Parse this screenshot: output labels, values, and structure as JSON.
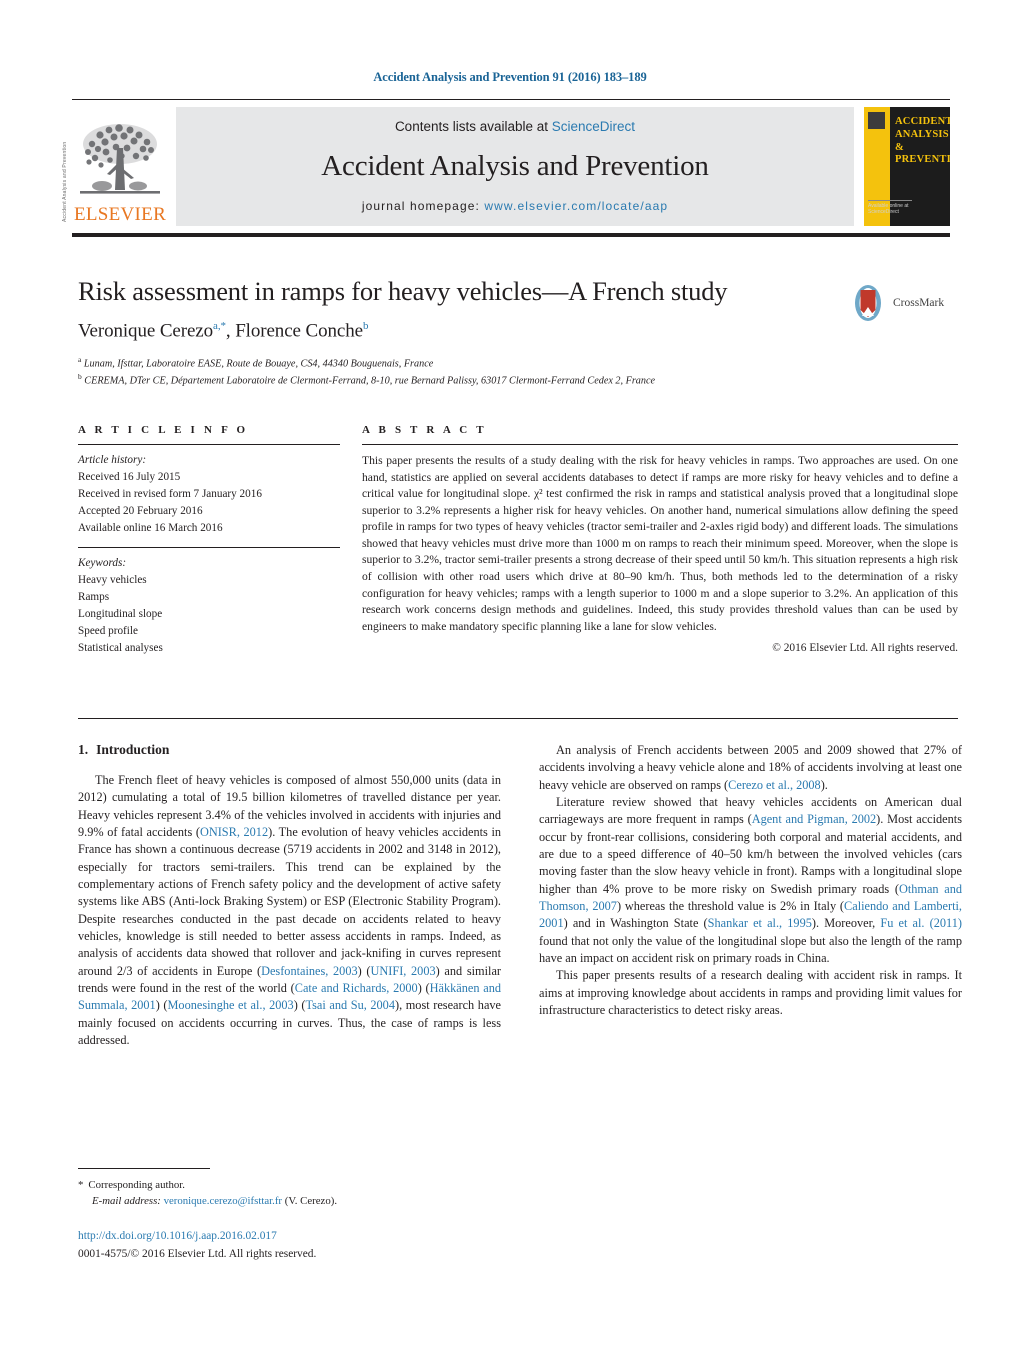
{
  "running_head": "Accident Analysis and Prevention 91 (2016) 183–189",
  "masthead": {
    "contents_prefix": "Contents lists available at ",
    "contents_link": "ScienceDirect",
    "journal_title": "Accident Analysis and Prevention",
    "homepage_prefix": "journal homepage: ",
    "homepage_url": "www.elsevier.com/locate/aap",
    "publisher_wordmark": "ELSEVIER",
    "cover_title": "ACCIDENT ANALYSIS & PREVENTION",
    "cover_footer": "Available online at ScienceDirect",
    "spine_text": "Accident Analysis and Prevention"
  },
  "article": {
    "title": "Risk assessment in ramps for heavy vehicles—A French study",
    "authors_html": "Veronique Cerezo<sup>a,*</sup>, Florence Conche<sup>b</sup>",
    "author_1": "Veronique Cerezo",
    "author_2": "Florence Conche",
    "affiliation_a": "Lunam, Ifsttar, Laboratoire EASE, Route de Bouaye, CS4, 44340 Bouguenais, France",
    "affiliation_b": "CEREMA, DTer CE, Département Laboratoire de Clermont-Ferrand, 8-10, rue Bernard Palissy, 63017 Clermont-Ferrand Cedex 2, France",
    "crossmark_label": "CrossMark"
  },
  "info": {
    "heading": "A R T I C L E   I N F O",
    "history_label": "Article history:",
    "history": [
      "Received 16 July 2015",
      "Received in revised form 7 January 2016",
      "Accepted 20 February 2016",
      "Available online 16 March 2016"
    ],
    "keywords_label": "Keywords:",
    "keywords": [
      "Heavy vehicles",
      "Ramps",
      "Longitudinal slope",
      "Speed profile",
      "Statistical analyses"
    ]
  },
  "abstract": {
    "heading": "A B S T R A C T",
    "text": "This paper presents the results of a study dealing with the risk for heavy vehicles in ramps. Two approaches are used. On one hand, statistics are applied on several accidents databases to detect if ramps are more risky for heavy vehicles and to define a critical value for longitudinal slope. χ² test confirmed the risk in ramps and statistical analysis proved that a longitudinal slope superior to 3.2% represents a higher risk for heavy vehicles. On another hand, numerical simulations allow defining the speed profile in ramps for two types of heavy vehicles (tractor semi-trailer and 2-axles rigid body) and different loads. The simulations showed that heavy vehicles must drive more than 1000 m on ramps to reach their minimum speed. Moreover, when the slope is superior to 3.2%, tractor semi-trailer presents a strong decrease of their speed until 50 km/h. This situation represents a high risk of collision with other road users which drive at 80–90 km/h. Thus, both methods led to the determination of a risky configuration for heavy vehicles; ramps with a length superior to 1000 m and a slope superior to 3.2%. An application of this research work concerns design methods and guidelines. Indeed, this study provides threshold values than can be used by engineers to make mandatory specific planning like a lane for slow vehicles.",
    "copyright": "© 2016 Elsevier Ltd. All rights reserved."
  },
  "section": {
    "number": "1.",
    "heading": "Introduction"
  },
  "body": {
    "left": [
      {
        "runs": [
          {
            "t": "The French fleet of heavy vehicles is composed of almost 550,000 units (data in 2012) cumulating a total of 19.5 billion kilometres of travelled distance per year. Heavy vehicles represent 3.4% of the vehicles involved in accidents with injuries and 9.9% of fatal accidents (",
            "k": "n"
          },
          {
            "t": "ONISR, 2012",
            "k": "r"
          },
          {
            "t": "). The evolution of heavy vehicles accidents in France has shown a continuous decrease (5719 accidents in 2002 and 3148 in 2012), especially for tractors semi-trailers. This trend can be explained by the complementary actions of French safety policy and the development of active safety systems like ABS (Anti-lock Braking System) or ESP (Electronic Stability Program). Despite researches conducted in the past decade on accidents related to heavy vehicles, knowledge is still needed to better assess accidents in ramps. Indeed, as analysis of accidents data showed that rollover and jack-knifing in curves represent around 2/3 of accidents in Europe (",
            "k": "n"
          },
          {
            "t": "Desfontaines, 2003",
            "k": "r"
          },
          {
            "t": ") (",
            "k": "n"
          },
          {
            "t": "UNIFI, 2003",
            "k": "r"
          },
          {
            "t": ") and similar trends were found in the rest of the world (",
            "k": "n"
          },
          {
            "t": "Cate and Richards, 2000",
            "k": "r"
          },
          {
            "t": ") (",
            "k": "n"
          },
          {
            "t": "Häkkänen and Summala, 2001",
            "k": "r"
          },
          {
            "t": ") (",
            "k": "n"
          },
          {
            "t": "Moonesinghe et al., 2003",
            "k": "r"
          },
          {
            "t": ") (",
            "k": "n"
          },
          {
            "t": "Tsai and Su, 2004",
            "k": "r"
          },
          {
            "t": "), most research have mainly focused on accidents occurring in curves. Thus, the case of ramps is less addressed.",
            "k": "n"
          }
        ]
      }
    ],
    "right": [
      {
        "runs": [
          {
            "t": "An analysis of French accidents between 2005 and 2009 showed that 27% of accidents involving a heavy vehicle alone and 18% of accidents involving at least one heavy vehicle are observed on ramps (",
            "k": "n"
          },
          {
            "t": "Cerezo et al., 2008",
            "k": "r"
          },
          {
            "t": ").",
            "k": "n"
          }
        ]
      },
      {
        "runs": [
          {
            "t": "Literature review showed that heavy vehicles accidents on American dual carriageways are more frequent in ramps (",
            "k": "n"
          },
          {
            "t": "Agent and Pigman, 2002",
            "k": "r"
          },
          {
            "t": "). Most accidents occur by front-rear collisions, considering both corporal and material accidents, and are due to a speed difference of 40–50 km/h between the involved vehicles (cars moving faster than the slow heavy vehicle in front). Ramps with a longitudinal slope higher than 4% prove to be more risky on Swedish primary roads (",
            "k": "n"
          },
          {
            "t": "Othman and Thomson, 2007",
            "k": "r"
          },
          {
            "t": ") whereas the threshold value is 2% in Italy (",
            "k": "n"
          },
          {
            "t": "Caliendo and Lamberti, 2001",
            "k": "r"
          },
          {
            "t": ") and in Washington State (",
            "k": "n"
          },
          {
            "t": "Shankar et al., 1995",
            "k": "r"
          },
          {
            "t": "). Moreover, ",
            "k": "n"
          },
          {
            "t": "Fu et al. (2011)",
            "k": "r"
          },
          {
            "t": " found that not only the value of the longitudinal slope but also the length of the ramp have an impact on accident risk on primary roads in China.",
            "k": "n"
          }
        ]
      },
      {
        "runs": [
          {
            "t": "This paper presents results of a research dealing with accident risk in ramps. It aims at improving knowledge about accidents in ramps and providing limit values for infrastructure characteristics to detect risky areas.",
            "k": "n"
          }
        ]
      }
    ]
  },
  "footer": {
    "corresponding_marker": "*",
    "corresponding_text": "Corresponding author.",
    "email_label": "E-mail address:",
    "email": "veronique.cerezo@ifsttar.fr",
    "email_owner": "(V. Cerezo).",
    "doi": "http://dx.doi.org/10.1016/j.aap.2016.02.017",
    "issn_line_prefix": "0001-4575/",
    "issn_line_rest": "© 2016 Elsevier Ltd. All rights reserved."
  },
  "colors": {
    "link": "#2a7ab0",
    "elsevier_orange": "#e87722",
    "band_gray": "#e6e7e8",
    "cover_yellow": "#f4c20d"
  }
}
